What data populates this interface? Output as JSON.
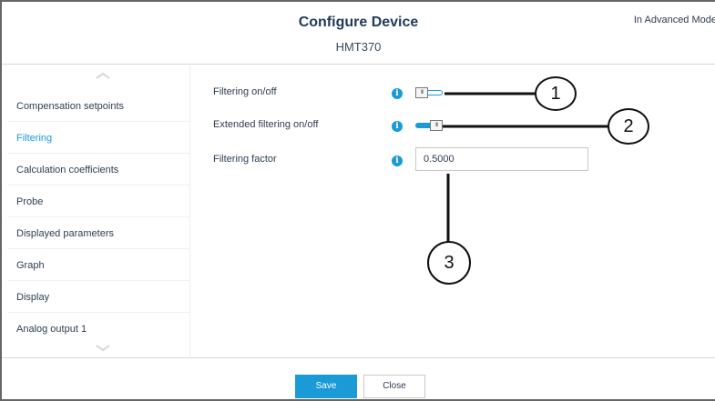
{
  "header": {
    "title": "Configure Device",
    "subtitle": "HMT370",
    "mode_text": "In Advanced Mode"
  },
  "sidebar": {
    "items": [
      {
        "label": "Compensation setpoints",
        "active": false
      },
      {
        "label": "Filtering",
        "active": true
      },
      {
        "label": "Calculation coefficients",
        "active": false
      },
      {
        "label": "Probe",
        "active": false
      },
      {
        "label": "Displayed parameters",
        "active": false
      },
      {
        "label": "Graph",
        "active": false
      },
      {
        "label": "Display",
        "active": false
      },
      {
        "label": "Analog output 1",
        "active": false
      }
    ]
  },
  "settings": {
    "filtering_onoff": {
      "label": "Filtering on/off",
      "state": "off"
    },
    "extended_filtering": {
      "label": "Extended filtering on/off",
      "state": "on"
    },
    "filtering_factor": {
      "label": "Filtering factor",
      "value": "0.5000"
    }
  },
  "footer": {
    "save_label": "Save",
    "close_label": "Close"
  },
  "callouts": [
    "1",
    "2",
    "3"
  ],
  "colors": {
    "accent": "#1a9ad6",
    "text": "#2d3e52",
    "title": "#1f3a5a"
  }
}
